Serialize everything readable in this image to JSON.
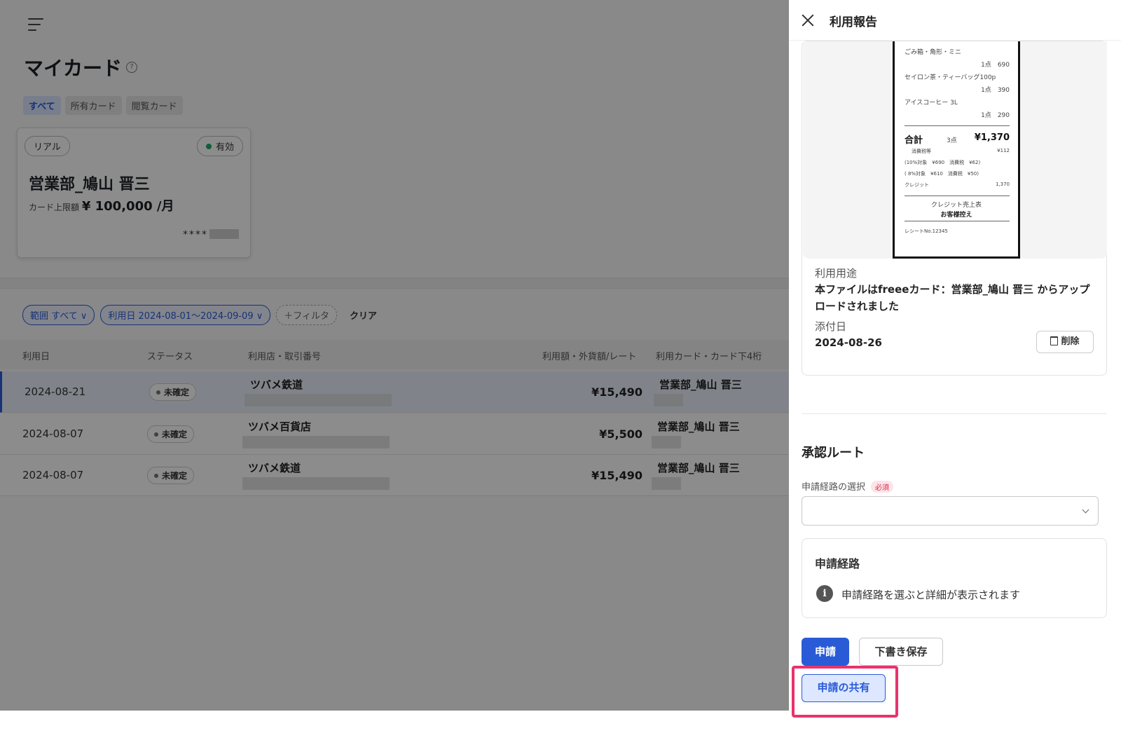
{
  "main": {
    "page_title": "マイカード",
    "tabs": [
      "すべて",
      "所有カード",
      "閲覧カード"
    ],
    "card": {
      "type_label": "リアル",
      "status_label": "有効",
      "holder_name": "営業部_鳩山 晋三",
      "limit_prefix": "カード上限額",
      "limit_value": "¥ 100,000 /月",
      "masked_number": "****"
    },
    "filters": {
      "range": "範囲 すべて",
      "date": "利用日 2024-08-01〜2024-09-09",
      "add_filter": "＋フィルタ",
      "clear": "クリア"
    },
    "table": {
      "headers": [
        "利用日",
        "ステータス",
        "利用店・取引番号",
        "利用額・外貨額/レート",
        "利用カード・カード下4桁"
      ],
      "rows": [
        {
          "date": "2024-08-21",
          "status": "未確定",
          "store": "ツバメ鉄道",
          "amount": "¥15,490",
          "card": "営業部_鳩山 晋三"
        },
        {
          "date": "2024-08-07",
          "status": "未確定",
          "store": "ツバメ百貨店",
          "amount": "¥5,500",
          "card": "営業部_鳩山 晋三"
        },
        {
          "date": "2024-08-07",
          "status": "未確定",
          "store": "ツバメ鉄道",
          "amount": "¥15,490",
          "card": "営業部_鳩山 晋三"
        }
      ]
    }
  },
  "drawer": {
    "title": "利用報告",
    "receipt": {
      "items": [
        {
          "name": "ごみ箱・角形・ミニ",
          "qty": "1点",
          "price": "690"
        },
        {
          "name": "セイロン茶・ティーバッグ100p",
          "qty": "1点",
          "price": "390"
        },
        {
          "name": "アイスコーヒー 3L",
          "qty": "1点",
          "price": "290"
        }
      ],
      "total_label": "合計",
      "total_qty": "3点",
      "total_value": "¥1,370",
      "tax_label": "消費税等",
      "tax_value": "¥112",
      "tax10": "(10%対象　¥690　消費税　¥62)",
      "tax8": "( 8%対象　¥610　消費税　¥50)",
      "credit_label": "クレジット",
      "credit_value": "1,370",
      "slip_title": "クレジット売上表",
      "slip_sub": "お客様控え",
      "receipt_no": "レシートNo.12345"
    },
    "usage_label": "利用用途",
    "usage_text": "本ファイルはfreeeカード：営業部_鳩山 晋三 からアップロードされました",
    "attached_label": "添付日",
    "attached_date": "2024-08-26",
    "delete_label": "削除",
    "approval_title": "承認ルート",
    "route_select_label": "申請経路の選択",
    "required_badge": "必須",
    "route_box_title": "申請経路",
    "route_box_message": "申請経路を選ぶと詳細が表示されます",
    "apply_button": "申請",
    "draft_button": "下書き保存",
    "share_button": "申請の共有"
  },
  "colors": {
    "accent": "#2a5bd7",
    "highlight": "#e8336c",
    "status_active": "#1fa96a",
    "required": "#d02a4a"
  }
}
